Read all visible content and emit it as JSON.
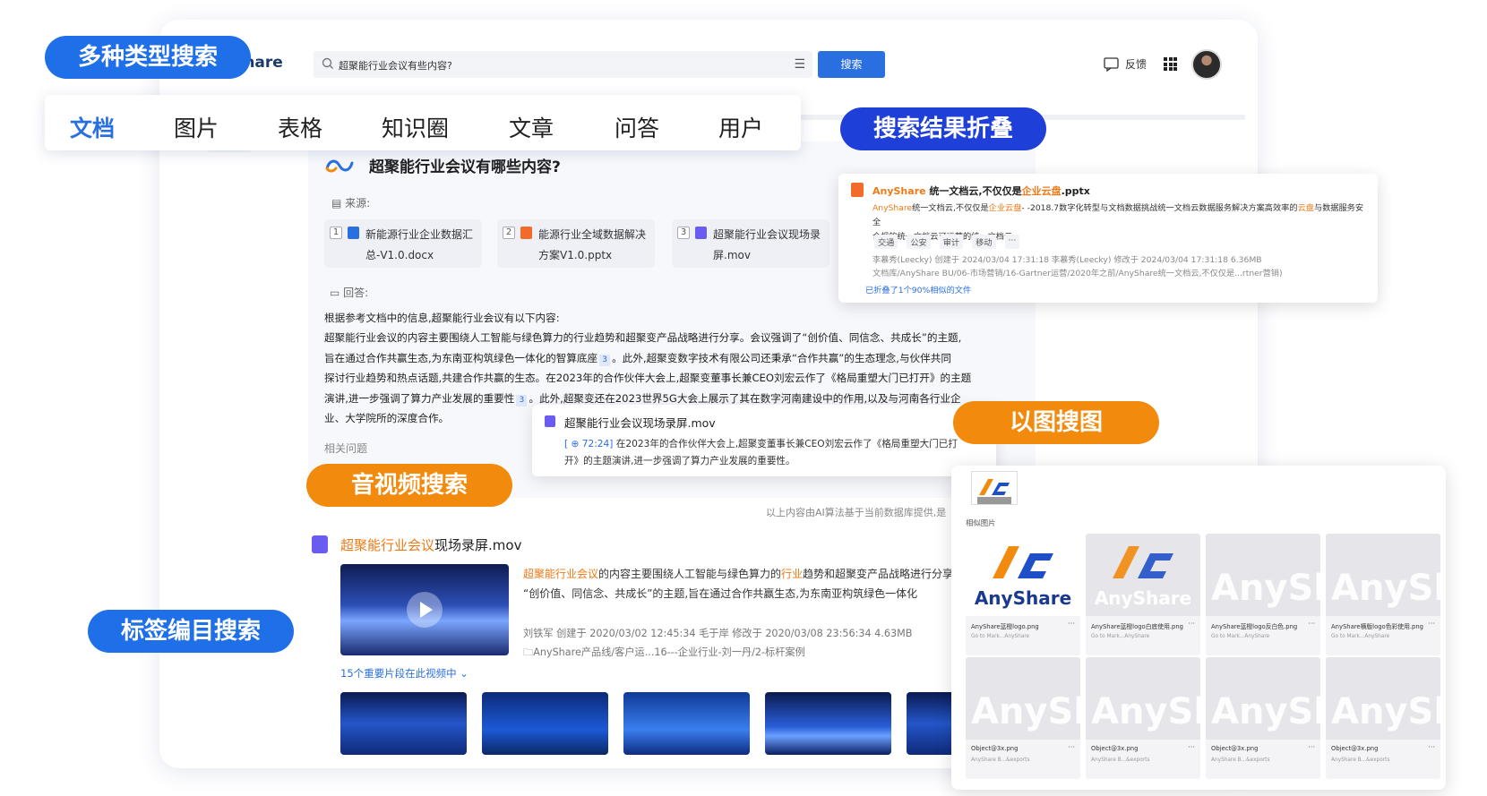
{
  "app": {
    "logo_text": "yShare"
  },
  "search": {
    "query": "超聚能行业会议有些内容?",
    "button": "搜索"
  },
  "header": {
    "feedback": "反馈"
  },
  "features": {
    "multi_type": "多种类型搜索",
    "fold": "搜索结果折叠",
    "av": "音视频搜索",
    "image": "以图搜图",
    "tag": "标签编目搜索"
  },
  "tabs": [
    "文档",
    "图片",
    "表格",
    "知识圈",
    "文章",
    "问答",
    "用户"
  ],
  "ai": {
    "question": "超聚能行业会议有哪些内容?",
    "sources_label": "来源:",
    "sources": [
      {
        "n": "1",
        "line1": "新能源行业企业数据汇",
        "line2": "总-V1.0.docx",
        "color": "#2a6fe0"
      },
      {
        "n": "2",
        "line1": "能源行业全域数据解决",
        "line2": "方案V1.0.pptx",
        "color": "#f26b2a"
      },
      {
        "n": "3",
        "line1": "超聚能行业会议现场录",
        "line2": "屏.mov",
        "color": "#6a5cf0"
      }
    ],
    "answer_label": "回答:",
    "answer_lines": [
      "根据参考文档中的信息,超聚能行业会议有以下内容:",
      "超聚能行业会议的内容主要围绕人工智能与绿色算力的行业趋势和超聚变产品战略进行分享。会议强调了“创价值、同信念、共成长”的主题,",
      "旨在通过合作共赢生态,为东南亚构筑绿色一体化的智算底座",
      "。此外,超聚变数字技术有限公司还秉承“合作共赢”的生态理念,与伙伴共同",
      "探讨行业趋势和热点话题,共建合作共赢的生态。在2023年的合作伙伴大会上,超聚变董事长兼CEO刘宏云作了《格局重塑大门已打开》的主题",
      "演讲,进一步强调了算力产业发展的重要性",
      "。此外,超聚变还在2023世界5G大会上展示了其在数字河南建设中的作用,以及与河南各行业企",
      "业、大学院所的深度合作。"
    ],
    "cite": "3",
    "related": "相关问题",
    "disclaimer": "以上内容由AI算法基于当前数据库提供,是"
  },
  "popup": {
    "title": "超聚能行业会议现场录屏.mov",
    "timestamp": "[ ⊕ 72:24]",
    "line1": "在2023年的合作伙伴大会上,超聚变董事长兼CEO刘宏云作了《格局重塑大门已打",
    "line2": "开》的主题演讲,进一步强调了算力产业发展的重要性。"
  },
  "result": {
    "title_hl": "超聚能行业会议",
    "title_rest": "现场录屏.mov",
    "snip1_hl": "超聚能行业会议",
    "snip1_mid": "的内容主要围绕人工智能与绿色算力的",
    "snip1_hl2": "行业",
    "snip1_rest": "趋势和超聚变产品战略进行分享",
    "snip2": "“创价值、同信念、共成长”的主题,旨在通过合作共赢生态,为东南亚构筑绿色一体化",
    "meta1": "刘铁军 创建于 2020/03/02  12:45:34    毛于岸 修改于 2020/03/08  23:56:34    4.63MB",
    "meta2": "AnyShare产品线/客户运...16---企业行业-刘一丹/2-标杆案例",
    "segments": "15个重要片段在此视频中  ⌄"
  },
  "fold": {
    "title_pre": "AnyShare",
    "title_mid": " 统一文档云,不仅仅是",
    "title_hl": "企业云盘",
    "title_ext": ".pptx",
    "body1_pre": "AnyShare",
    "body1_mid": "统一文档云,不仅仅是",
    "body1_hl": "企业云盘",
    "body1_rest": "- -2018.7数字化转型与文档数据挑战统一文档云数据服务解决方案高效率的",
    "body1_hl2": "云盘",
    "body1_end": "与数据服务安全",
    "body2": "合规的统一文档云可运营的统一文档云",
    "tags": [
      "交通",
      "公安",
      "审计",
      "移动",
      "···"
    ],
    "meta1": "李慕秀(Leecky) 创建于 2024/03/04 17:31:18  李慕秀(Leecky) 修改于 2024/03/04 17:31:18  6.36MB",
    "meta2": "文档库/AnyShare BU/06-市场营销/16-Gartner运营/2020年之前/AnyShare统一文档云,不仅仅是...rtner营销)",
    "folded": "已折叠了1个90%相似的文件"
  },
  "image_search": {
    "label": "相似图片",
    "tiles": [
      {
        "name": "AnyShare蓝橙logo.png",
        "sub": "Go to Mark...AnyShare",
        "type": "logo",
        "text": "AnyShare"
      },
      {
        "name": "AnyShare蓝橙logo白底使用.png",
        "sub": "Go to Mark...AnyShare",
        "type": "logo-light",
        "text": "AnyShare"
      },
      {
        "name": "AnyShare蓝橙logo反白色.png",
        "sub": "Go to Mark...AnyShare",
        "type": "ghost",
        "text": "AnyShare"
      },
      {
        "name": "AnyShare横版logo色彩使用.png",
        "sub": "Go to Mark...AnyShare",
        "type": "ghost",
        "text": "AnySh"
      },
      {
        "name": "Object@3x.png",
        "sub": "AnyShare B...&exports",
        "type": "ghost",
        "text": "AnySh"
      },
      {
        "name": "Object@3x.png",
        "sub": "AnyShare B...&exports",
        "type": "ghost",
        "text": "AnySh"
      },
      {
        "name": "Object@3x.png",
        "sub": "AnyShare B...&exports",
        "type": "ghost",
        "text": "AnySh"
      },
      {
        "name": "Object@3x.png",
        "sub": "AnyShare B...&exports",
        "type": "ghost",
        "text": "AnySh"
      }
    ]
  },
  "colors": {
    "accent": "#2a6fe0",
    "orange": "#f28a0d",
    "pill_blue": "#1f6fe8",
    "pill_dark_blue": "#1e3fd8"
  }
}
